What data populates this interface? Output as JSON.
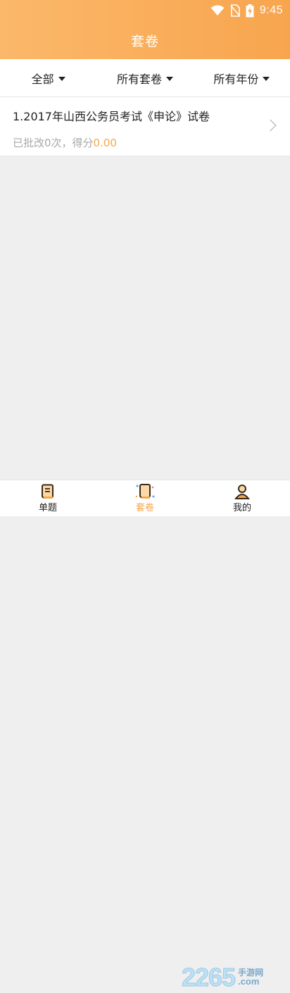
{
  "status": {
    "time": "9:45"
  },
  "header": {
    "title": "套卷"
  },
  "filters": [
    {
      "label": "全部"
    },
    {
      "label": "所有套卷"
    },
    {
      "label": "所有年份"
    }
  ],
  "papers": [
    {
      "title": "1.2017年山西公务员考试《申论》试卷",
      "meta_prefix": "已批改0次，得分",
      "score": "0.00"
    }
  ],
  "tabs": [
    {
      "label": "单题",
      "icon": "book-icon"
    },
    {
      "label": "套卷",
      "icon": "paper-set-icon"
    },
    {
      "label": "我的",
      "icon": "user-icon"
    }
  ],
  "watermark": {
    "number": "2265",
    "cn": "手游网",
    "com": ".com"
  },
  "colors": {
    "accent": "#f5a74b",
    "header_start": "#fbb86a",
    "header_end": "#f8a54e"
  }
}
